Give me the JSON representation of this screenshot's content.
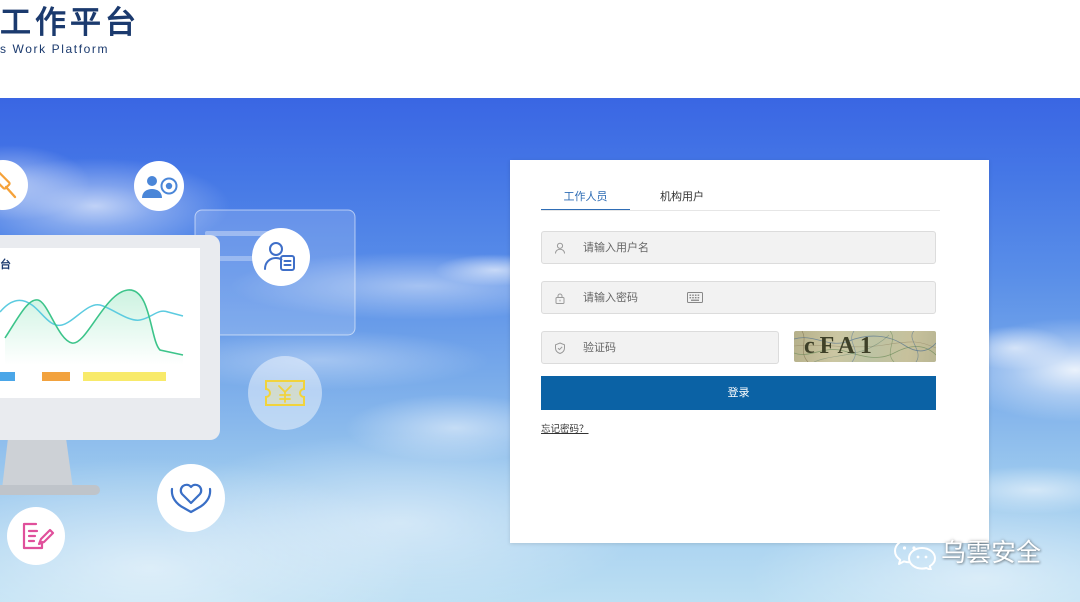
{
  "header": {
    "logo_title": "工作平台",
    "logo_subtitle": "s Work Platform"
  },
  "illustration": {
    "screen_text": "台",
    "icons": [
      "hammer-icon",
      "id-badge-icon",
      "user-document-icon",
      "ticket-icon",
      "heart-hands-icon",
      "document-edit-icon"
    ]
  },
  "login": {
    "tabs": [
      {
        "label": "工作人员",
        "active": true
      },
      {
        "label": "机构用户",
        "active": false
      }
    ],
    "username": {
      "placeholder": "请输入用户名",
      "icon": "user-icon"
    },
    "password": {
      "placeholder": "请输入密码",
      "icon": "lock-icon",
      "extra_icon": "keyboard-icon"
    },
    "captcha": {
      "placeholder": "验证码",
      "icon": "shield-icon",
      "image_text": "cFA1"
    },
    "submit_label": "登录",
    "forgot_label": "忘记密码？"
  },
  "watermark": {
    "text": "乌雲安全",
    "icon": "wechat-icon"
  },
  "colors": {
    "accent": "#0b62a5",
    "tab_active": "#2f6db5",
    "logo": "#1b3a6e"
  }
}
